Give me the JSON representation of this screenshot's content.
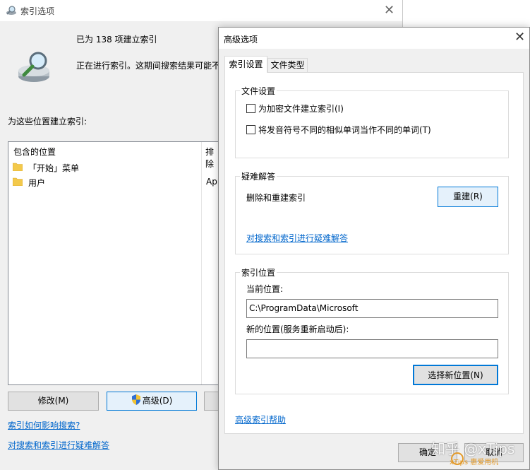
{
  "back_window": {
    "title": "索引选项",
    "status_title": "已为 138 项建立索引",
    "status_text": "正在进行索引。这期间搜索结果可能不",
    "locations_label": "为这些位置建立索引:",
    "columns": {
      "included": "包含的位置",
      "excluded": "排除"
    },
    "locations": [
      {
        "name": "「开始」菜单",
        "excluded": ""
      },
      {
        "name": "用户",
        "excluded": "App"
      }
    ],
    "buttons": {
      "modify": "修改(M)",
      "advanced": "高级(D)"
    },
    "links": {
      "how_affects": "索引如何影响搜索?",
      "troubleshoot": "对搜索和索引进行疑难解答"
    }
  },
  "dialog": {
    "title": "高级选项",
    "tabs": [
      {
        "label": "索引设置"
      },
      {
        "label": "文件类型"
      }
    ],
    "file_settings": {
      "title": "文件设置",
      "options": [
        {
          "label": "为加密文件建立索引(I)",
          "checked": false
        },
        {
          "label": "将发音符号不同的相似单词当作不同的单词(T)",
          "checked": false
        }
      ]
    },
    "troubleshooting": {
      "title": "疑难解答",
      "rebuild_label": "删除和重建索引",
      "rebuild_button": "重建(R)",
      "link": "对搜索和索引进行疑难解答"
    },
    "index_location": {
      "title": "索引位置",
      "current_label": "当前位置:",
      "current_value": "C:\\ProgramData\\Microsoft",
      "new_label": "新的位置(服务重新启动后):",
      "new_value": "",
      "select_button": "选择新位置(N)"
    },
    "help_link": "高级索引帮助",
    "ok_button": "确定",
    "cancel_button": "取消"
  },
  "watermark": {
    "text": "知乎 @xTips",
    "sub": "xTips 惠爱用机"
  },
  "colors": {
    "accent": "#0078d7",
    "link": "#0066cc",
    "folder": "#f3c94b"
  }
}
